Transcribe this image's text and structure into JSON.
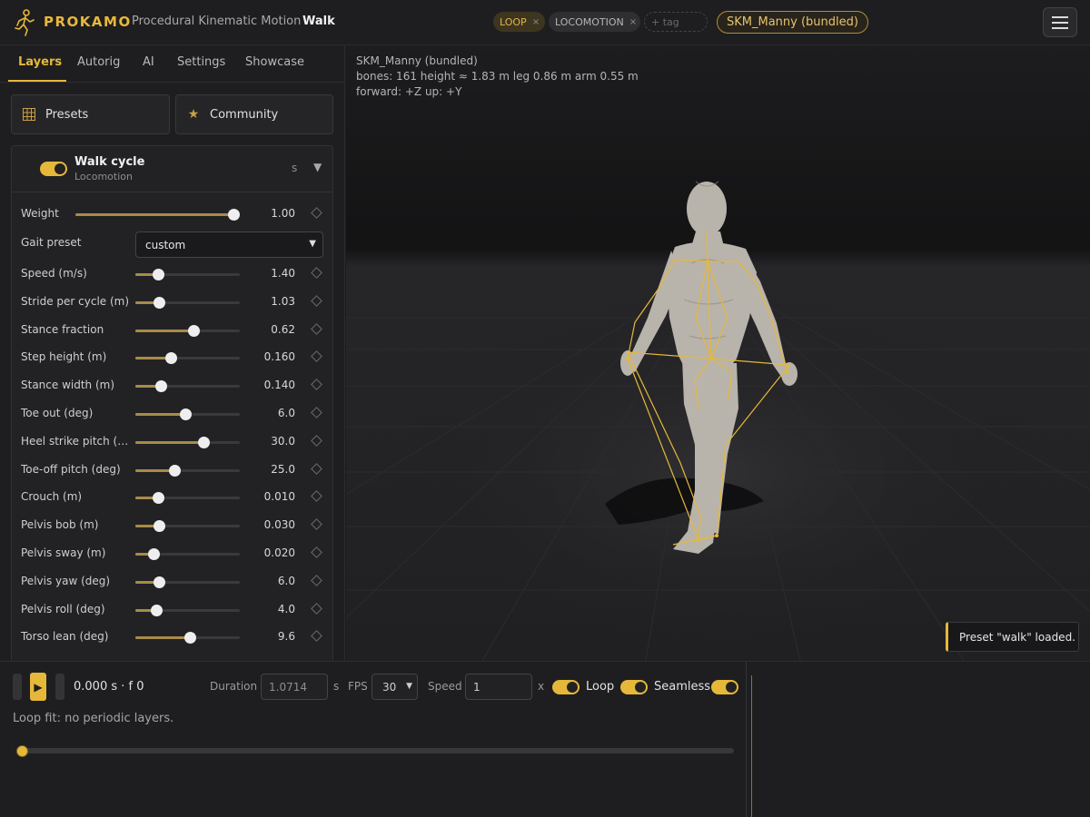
{
  "header": {
    "brand": "PROKAMO",
    "subtitle": "Procedural Kinematic Motion",
    "animation": "Walk",
    "tags": [
      {
        "label": "LOOP",
        "remove": "×"
      },
      {
        "label": "LOCOMOTION",
        "remove": "×"
      }
    ],
    "add_tag_placeholder": "+ tag",
    "model": "SKM_Manny (bundled)",
    "icons": {
      "logo": "walking-figure-icon",
      "menu": "hamburger-menu-icon"
    }
  },
  "sidebar": {
    "tabs": [
      "Layers",
      "Autorig",
      "AI",
      "Settings",
      "Showcase"
    ],
    "active_tab": "Layers",
    "presets_label": "Presets",
    "community_label": "Community",
    "layer": {
      "title": "Walk cycle",
      "subtitle": "Locomotion",
      "suffix": "s",
      "enabled": true,
      "weight_label": "Weight",
      "weight_value": "1.00",
      "weight_fraction": 0.96,
      "gait_label": "Gait preset",
      "gait_value": "custom",
      "params": [
        {
          "label": "Speed (m/s)",
          "value": "1.40",
          "fraction": 0.22
        },
        {
          "label": "Stride per cycle (m)",
          "value": "1.03",
          "fraction": 0.23
        },
        {
          "label": "Stance fraction",
          "value": "0.62",
          "fraction": 0.56
        },
        {
          "label": "Step height (m)",
          "value": "0.160",
          "fraction": 0.34
        },
        {
          "label": "Stance width (m)",
          "value": "0.140",
          "fraction": 0.24
        },
        {
          "label": "Toe out (deg)",
          "value": "6.0",
          "fraction": 0.48
        },
        {
          "label": "Heel strike pitch (deg)",
          "value": "30.0",
          "fraction": 0.65
        },
        {
          "label": "Toe-off pitch (deg)",
          "value": "25.0",
          "fraction": 0.37
        },
        {
          "label": "Crouch (m)",
          "value": "0.010",
          "fraction": 0.22
        },
        {
          "label": "Pelvis bob (m)",
          "value": "0.030",
          "fraction": 0.23
        },
        {
          "label": "Pelvis sway (m)",
          "value": "0.020",
          "fraction": 0.17
        },
        {
          "label": "Pelvis yaw (deg)",
          "value": "6.0",
          "fraction": 0.23
        },
        {
          "label": "Pelvis roll (deg)",
          "value": "4.0",
          "fraction": 0.2
        },
        {
          "label": "Torso lean (deg)",
          "value": "9.6",
          "fraction": 0.52
        }
      ]
    }
  },
  "viewport": {
    "info_lines": [
      "SKM_Manny (bundled)",
      "bones: 161   height ≈ 1.83 m   leg 0.86 m   arm 0.55 m",
      "forward: +Z  up: +Y"
    ],
    "toast": "Preset \"walk\" loaded."
  },
  "timeline": {
    "time_display": "0.000 s · f 0",
    "duration_label": "Duration",
    "duration_value": "1.0714",
    "duration_unit": "s",
    "fps_label": "FPS",
    "fps_value": "30",
    "speed_label": "Speed",
    "speed_value": "1",
    "speed_unit": "x",
    "loop_label": "Loop",
    "seamless_label": "Seamless",
    "loop_fit": "Loop fit: no periodic layers.",
    "scrub_fraction": 0
  },
  "colors": {
    "accent": "#e6b83a",
    "background": "#1c1c1e",
    "panel": "#1e1e20"
  }
}
